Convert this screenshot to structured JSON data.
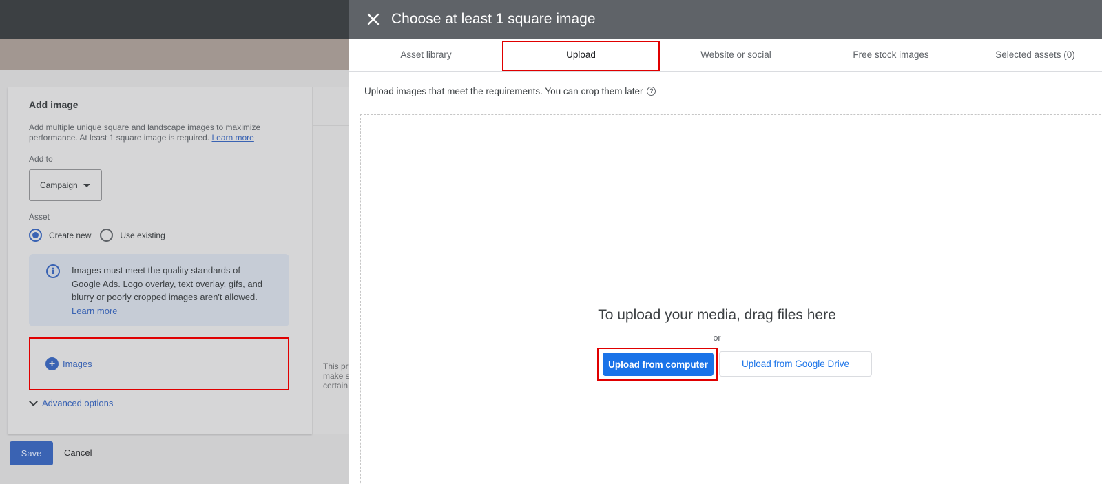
{
  "background": {
    "card": {
      "title": "Add image",
      "description": "Add multiple unique square and landscape images to maximize performance. At least 1 square image is required.",
      "description_link": "Learn more",
      "add_to_label": "Add to",
      "add_to_value": "Campaign",
      "asset_label": "Asset",
      "radio_create_new": "Create new",
      "radio_use_existing": "Use existing",
      "info_text": "Images must meet the quality standards of Google Ads. Logo overlay, text overlay, gifs, and blurry or poorly cropped images aren't allowed.",
      "info_link": "Learn more",
      "images_button": "Images",
      "advanced_options": "Advanced options",
      "side_cut_text": [
        "This pr",
        "make s",
        "certain"
      ]
    },
    "footer": {
      "save_label": "Save",
      "cancel_label": "Cancel"
    }
  },
  "panel": {
    "title": "Choose at least 1 square image",
    "tabs": [
      {
        "label": "Asset library"
      },
      {
        "label": "Upload"
      },
      {
        "label": "Website or social"
      },
      {
        "label": "Free stock images"
      },
      {
        "label": "Selected assets (0)"
      }
    ],
    "active_tab": "Upload",
    "requirements_text": "Upload images that meet the requirements. You can crop them later",
    "help_glyph": "?",
    "dropzone": {
      "title": "To upload your media, drag files here",
      "or_text": "or",
      "upload_computer_label": "Upload from computer",
      "upload_drive_label": "Upload from Google Drive"
    }
  },
  "colors": {
    "header_bg": "#5f6368",
    "primary": "#1a73e8",
    "highlight": "#e00000"
  }
}
